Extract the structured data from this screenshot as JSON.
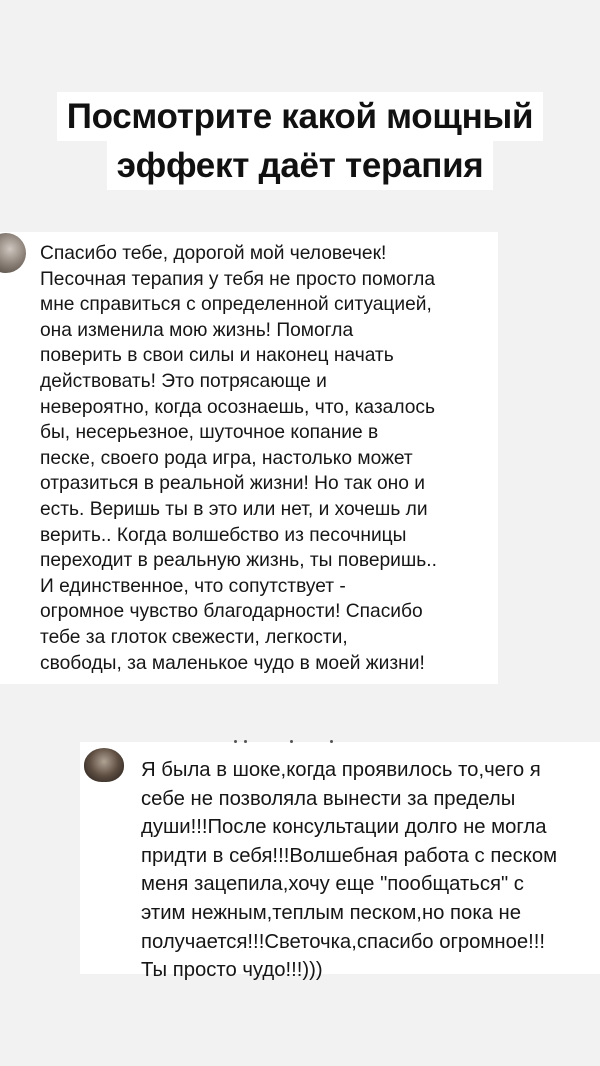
{
  "headline": {
    "line1": "Посмотрите какой мощный",
    "line2": "эффект даёт терапия"
  },
  "reviews": [
    {
      "text": "Спасибо тебе, дорогой мой человечек!\nПесочная терапия у тебя не просто помогла\nмне справиться с определенной ситуацией,\nона изменила мою жизнь! Помогла\nповерить в свои силы и наконец начать\nдействовать! Это потрясающе и\nневероятно, когда осознаешь, что, казалось\nбы, несерьезное, шуточное копание в\nпеске, своего рода игра, настолько может\nотразиться в реальной жизни! Но так оно и\nесть. Веришь ты в это или нет, и хочешь ли\nверить.. Когда волшебство из песочницы\nпереходит в реальную жизнь, ты поверишь..\nИ единственное, что сопутствует -\nогромное чувство благодарности! Спасибо\nтебе за глоток свежести, легкости,\nсвободы, за маленькое чудо в моей жизни!"
    },
    {
      "text": "Я была в шоке,когда проявилось то,чего я\nсебе не позволяла вынести за пределы\nдуши!!!После консультации долго не могла\nпридти в себя!!!Волшебная работа с песком\nменя зацепила,хочу еще \"пообщаться\" с\nэтим нежным,теплым песком,но пока не\nполучается!!!Светочка,спасибо огромное!!!\nТы просто чудо!!!)))"
    }
  ]
}
